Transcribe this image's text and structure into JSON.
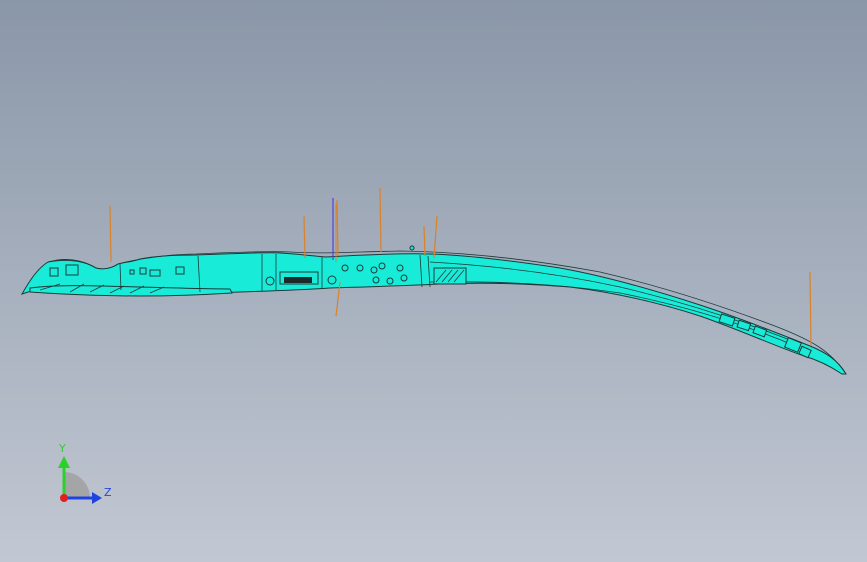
{
  "viewport": {
    "background_top": "#8a97a8",
    "background_bottom": "#c2c8d3"
  },
  "model": {
    "fill_color": "#18ecd8",
    "edge_color": "#1c3a3a",
    "leader_line_color": "#d9822b",
    "origin_y_axis_color": "#5a3fd6"
  },
  "triad": {
    "y_label": "Y",
    "z_label": "Z",
    "y_color": "#2bd12b",
    "z_color": "#1f45e0",
    "x_color": "#e02020",
    "plane_color": "#a0a0a0"
  }
}
